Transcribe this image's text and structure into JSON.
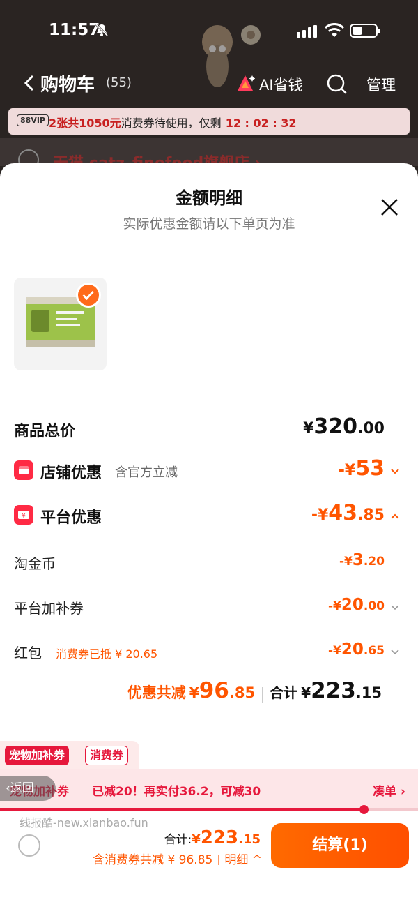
{
  "status_bar": {
    "time": "11:57"
  },
  "nav": {
    "title": "购物车",
    "count": "(55)",
    "ai_label": "AI省钱",
    "manage_label": "管理"
  },
  "coupon_banner": {
    "badge": "88VIP",
    "highlight": "2张共1050元",
    "text": "消费券待使用，仅剩",
    "timer": "12 : 02 : 32"
  },
  "store": {
    "name": "天猫 catz_finefood旗舰店 ›"
  },
  "sheet": {
    "title": "金额明细",
    "subtitle": "实际优惠金额请以下单页为准"
  },
  "rows": {
    "goods_total": {
      "label": "商品总价",
      "cur": "¥",
      "int": "320",
      "dec": ".00"
    },
    "store_discount": {
      "label": "店铺优惠",
      "note": "含官方立减",
      "cur": "-¥",
      "int": "53",
      "dec": ""
    },
    "platform_discount": {
      "label": "平台优惠",
      "cur": "-¥",
      "int": "43",
      "dec": ".85"
    },
    "taojinbi": {
      "label": "淘金币",
      "cur": "-¥",
      "int": "3",
      "dec": ".20"
    },
    "platform_coupon": {
      "label": "平台加补券",
      "cur": "-¥",
      "int": "20",
      "dec": ".00"
    },
    "red_packet": {
      "label": "红包",
      "note": "消费券已抵 ¥ 20.65",
      "cur": "-¥",
      "int": "20",
      "dec": ".65"
    }
  },
  "summary": {
    "discount_label": "优惠共减",
    "discount_cur": "¥",
    "discount_int": "96",
    "discount_dec": ".85",
    "total_label": "合计",
    "total_cur": "¥",
    "total_int": "223",
    "total_dec": ".15"
  },
  "tags": {
    "red": "宠物加补券",
    "outline": "消费券"
  },
  "promo": {
    "name": "宠物加补券",
    "text": "已减20！再实付36.2，可减30",
    "link": "凑单 ›",
    "progress": 0.87
  },
  "back_pill": "‹返回",
  "watermark": "线报酷-new.xianbao.fun",
  "footer": {
    "total_label": "合计:",
    "total_cur": "¥",
    "total_int": "223",
    "total_dec": ".15",
    "savings_text": "含消费券共减 ¥ 96.85",
    "detail_label": "明细 ^",
    "checkout_label": "结算(1)"
  },
  "colors": {
    "accent": "#ff5500",
    "brand_red": "#e6183c",
    "section_icon": "#ff2a44"
  }
}
